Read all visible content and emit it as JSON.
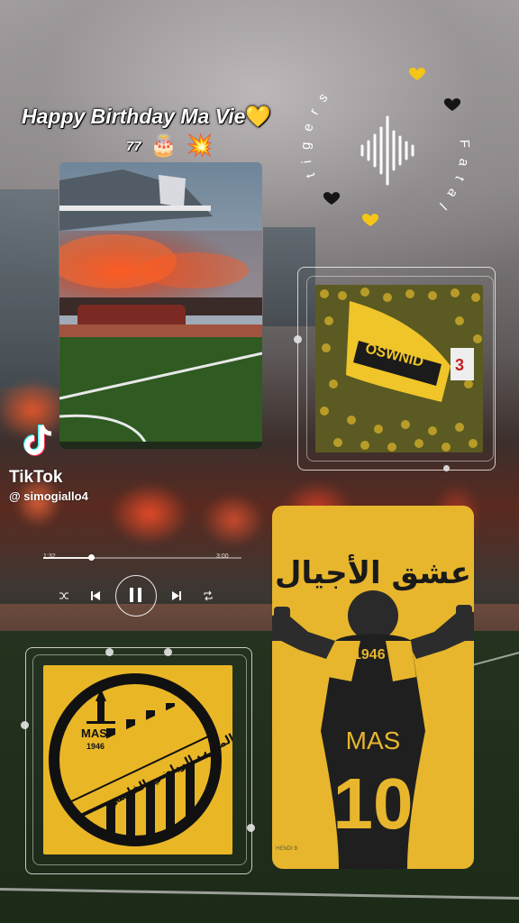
{
  "overlay": {
    "title": "Happy Birthday Ma Vie",
    "title_heart": "💛",
    "age": "77",
    "cake_emoji": "🎂",
    "spark_emoji": "💥",
    "circle_words": [
      "tigers",
      "Fatal"
    ]
  },
  "watermark": {
    "brand": "TikTok",
    "username": "@ simogiallo4"
  },
  "player": {
    "elapsed": "1:32",
    "total": "3:00",
    "progress": 0.24
  },
  "artwork": {
    "flag_text": "OSWNID",
    "banner_number": "3",
    "club_abbr": "MAS",
    "club_year": "1946",
    "club_arabic_name": "المغرب الرياضي الفاسي",
    "poster_arabic": "عشق الأجيال",
    "jersey_year": "1946",
    "jersey_text": "MAS",
    "jersey_number": "10",
    "credit": "HENDI B"
  },
  "colors": {
    "mas_yellow": "#e9b626",
    "heart_yellow": "#f5c518",
    "text_white": "#ffffff"
  }
}
